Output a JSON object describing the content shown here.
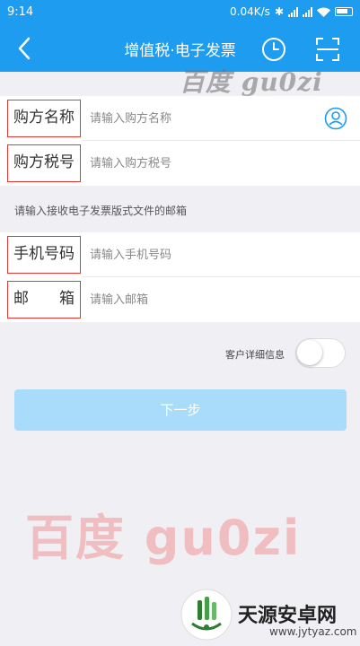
{
  "status_bar": {
    "time": "9:14",
    "speed": "0.04K/s",
    "bluetooth": "✱"
  },
  "nav": {
    "title": "增值税·电子发票",
    "back_icon": "chevron-left-icon",
    "history_icon": "clock-icon",
    "scan_icon": "scan-icon"
  },
  "form": {
    "buyer_name": {
      "label": "购方名称",
      "placeholder": "请输入购方名称"
    },
    "buyer_tax": {
      "label": "购方税号",
      "placeholder": "请输入购方税号"
    },
    "email_hint": "请输入接收电子发票版式文件的邮箱",
    "phone": {
      "label": "手机号码",
      "placeholder": "请输入手机号码"
    },
    "email": {
      "label": "邮　　箱",
      "placeholder": "请输入邮箱"
    }
  },
  "details_toggle": {
    "label": "客户详细信息",
    "on": false
  },
  "next_button": "下一步",
  "watermarks": {
    "top": "百度 gu0zi",
    "center": "百度  gu0zi"
  },
  "site": {
    "name": "天源安卓网",
    "url": "www.jytyaz.com"
  },
  "colors": {
    "header": "#1e9cf0",
    "button": "#a8dcfa",
    "highlight": "#e53935",
    "background": "#f0eff4"
  }
}
